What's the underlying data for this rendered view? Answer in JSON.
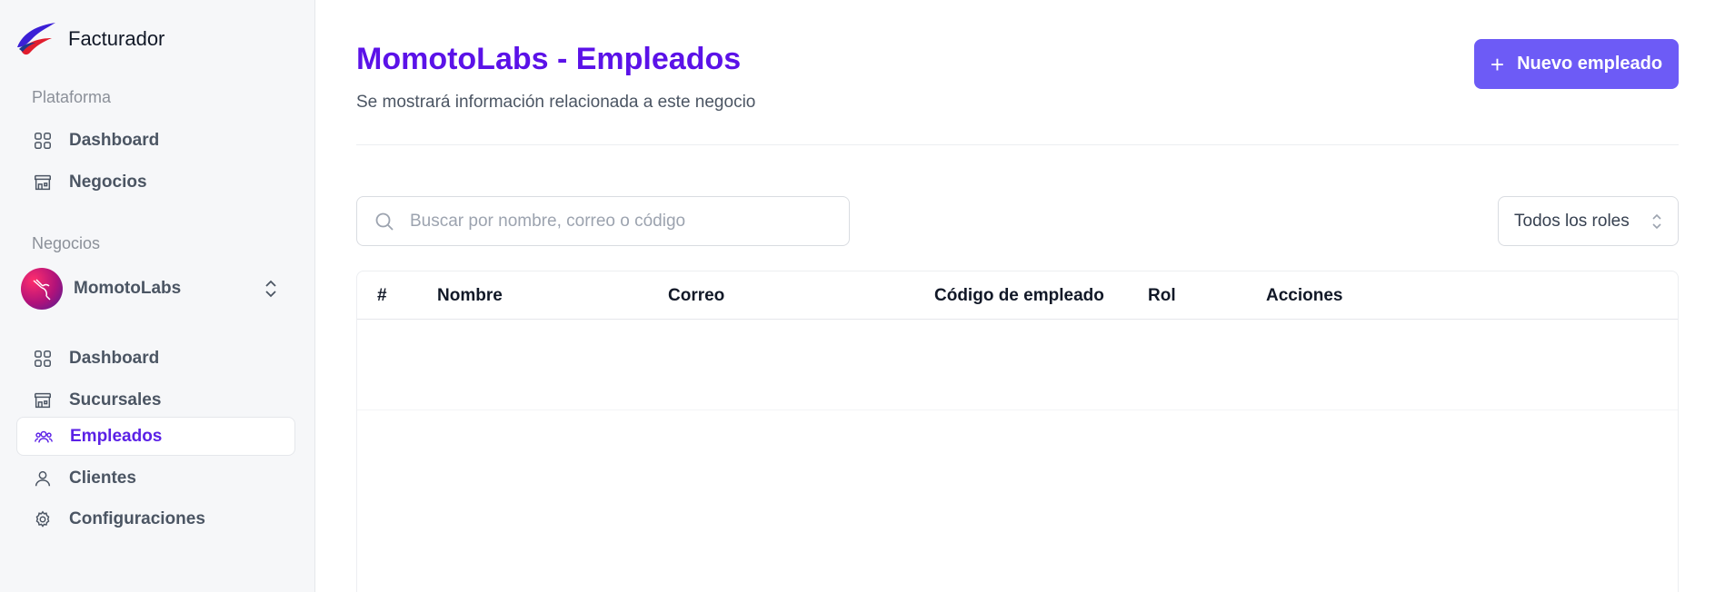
{
  "app": {
    "name": "Facturador"
  },
  "sidebar": {
    "platform_label": "Plataforma",
    "platform_items": [
      {
        "label": "Dashboard",
        "icon": "grid-icon"
      },
      {
        "label": "Negocios",
        "icon": "store-icon"
      }
    ],
    "business_label": "Negocios",
    "business_switcher": {
      "name": "MomotoLabs",
      "icon": "chevron-up-down-icon"
    },
    "business_items": [
      {
        "label": "Dashboard",
        "icon": "grid-icon",
        "active": false
      },
      {
        "label": "Sucursales",
        "icon": "store-icon",
        "active": false
      },
      {
        "label": "Empleados",
        "icon": "users-icon",
        "active": true
      },
      {
        "label": "Clientes",
        "icon": "user-icon",
        "active": false
      },
      {
        "label": "Configuraciones",
        "icon": "gear-icon",
        "active": false
      }
    ]
  },
  "header": {
    "title": "MomotoLabs - Empleados",
    "subtitle": "Se mostrará información relacionada a este negocio",
    "new_button_label": "Nuevo empleado"
  },
  "filters": {
    "search_placeholder": "Buscar por nombre, correo o código",
    "search_value": "",
    "role_selected": "Todos los roles"
  },
  "table": {
    "columns": [
      "#",
      "Nombre",
      "Correo",
      "Código de empleado",
      "Rol",
      "Acciones"
    ],
    "rows": []
  },
  "colors": {
    "accent": "#5b12e8",
    "button": "#6d5bf6",
    "sidebar_bg": "#f6f7f9"
  }
}
